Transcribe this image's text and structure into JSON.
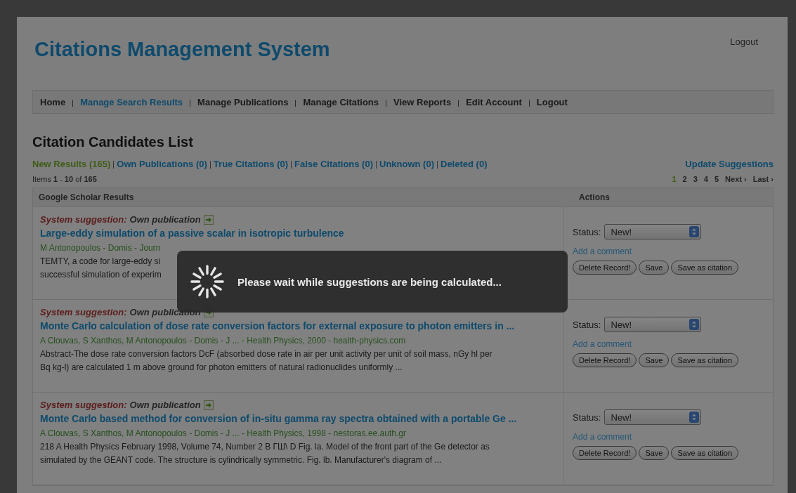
{
  "header": {
    "title": "Citations Management System",
    "logout": "Logout"
  },
  "nav": [
    {
      "label": "Home",
      "selected": false
    },
    {
      "label": "Manage Search Results",
      "selected": true
    },
    {
      "label": "Manage Publications",
      "selected": false
    },
    {
      "label": "Manage Citations",
      "selected": false
    },
    {
      "label": "View Reports",
      "selected": false
    },
    {
      "label": "Edit Account",
      "selected": false
    },
    {
      "label": "Logout",
      "selected": false
    }
  ],
  "heading": "Citation Candidates List",
  "filters": [
    {
      "label": "New Results (165)",
      "selected": true
    },
    {
      "label": "Own Publications (0)",
      "selected": false
    },
    {
      "label": "True Citations (0)",
      "selected": false
    },
    {
      "label": "False Citations (0)",
      "selected": false
    },
    {
      "label": "Unknown (0)",
      "selected": false
    },
    {
      "label": "Deleted (0)",
      "selected": false
    }
  ],
  "update_link": "Update Suggestions",
  "items_count": "Items **1** - **10** of **165**",
  "pagination": [
    {
      "label": "1",
      "selected": true
    },
    {
      "label": "2",
      "selected": false
    },
    {
      "label": "3",
      "selected": false
    },
    {
      "label": "4",
      "selected": false
    },
    {
      "label": "5",
      "selected": false
    },
    {
      "label": "Next ›",
      "selected": false
    },
    {
      "label": "Last ›",
      "selected": false
    }
  ],
  "table": {
    "columns": [
      "Google Scholar Results",
      "Actions"
    ],
    "rows": [
      {
        "suggestion_label": "System suggestion:",
        "suggestion": "Own publication",
        "title": "Large-eddy simulation of a passive scalar in isotropic turbulence",
        "authors": "M Antonopoulos - Domis - Journ",
        "snippet_lines": [
          "TEMTY, a code for large-eddy si",
          "successful simulation of experim"
        ],
        "status_label": "Status:",
        "status": "New!",
        "comment_link": "Add a comment",
        "buttons": [
          "Delete Record!",
          "Save",
          "Save as citation"
        ]
      },
      {
        "suggestion_label": "System suggestion:",
        "suggestion": "Own publication",
        "title": "Monte Carlo calculation of dose rate conversion factors for external exposure to photon emitters in ...",
        "authors": "A Clouvas, S Xanthos, M Antonopoulos - Domis - J ... - Health Physics, 2000 - health-physics.com",
        "snippet_lines": [
          "Abstract-The dose rate conversion factors DcF (absorbed dose rate in air per unit activity per unit of soil mass, nGy hl per",
          "Bq kg-l) are calculated 1 m above ground for photon emitters of natural radionuclides uniformly ..."
        ],
        "status_label": "Status:",
        "status": "New!",
        "comment_link": "Add a comment",
        "buttons": [
          "Delete Record!",
          "Save",
          "Save as citation"
        ]
      },
      {
        "suggestion_label": "System suggestion:",
        "suggestion": "Own publication",
        "title": "Monte Carlo based method for conversion of in-situ gamma ray spectra obtained with a portable Ge ...",
        "authors": "A Clouvas, S Xanthos, M Antonopoulos - Domis - J ... - Health Physics, 1998 - nestoras.ee.auth.gr",
        "snippet_lines": [
          "218 A Health Physics February 1998, Volume 74, Number 2 B ГШ\\ D Fig. la. Model of the front part of the Ge detector as",
          "simulated by the GEANT code. The structure is cylindrically symmetric. Fig. lb. Manufacturer's diagram of ..."
        ],
        "status_label": "Status:",
        "status": "New!",
        "comment_link": "Add a comment",
        "buttons": [
          "Delete Record!",
          "Save",
          "Save as citation"
        ]
      }
    ]
  },
  "loading": {
    "message": "Please wait while suggestions are being calculated..."
  }
}
